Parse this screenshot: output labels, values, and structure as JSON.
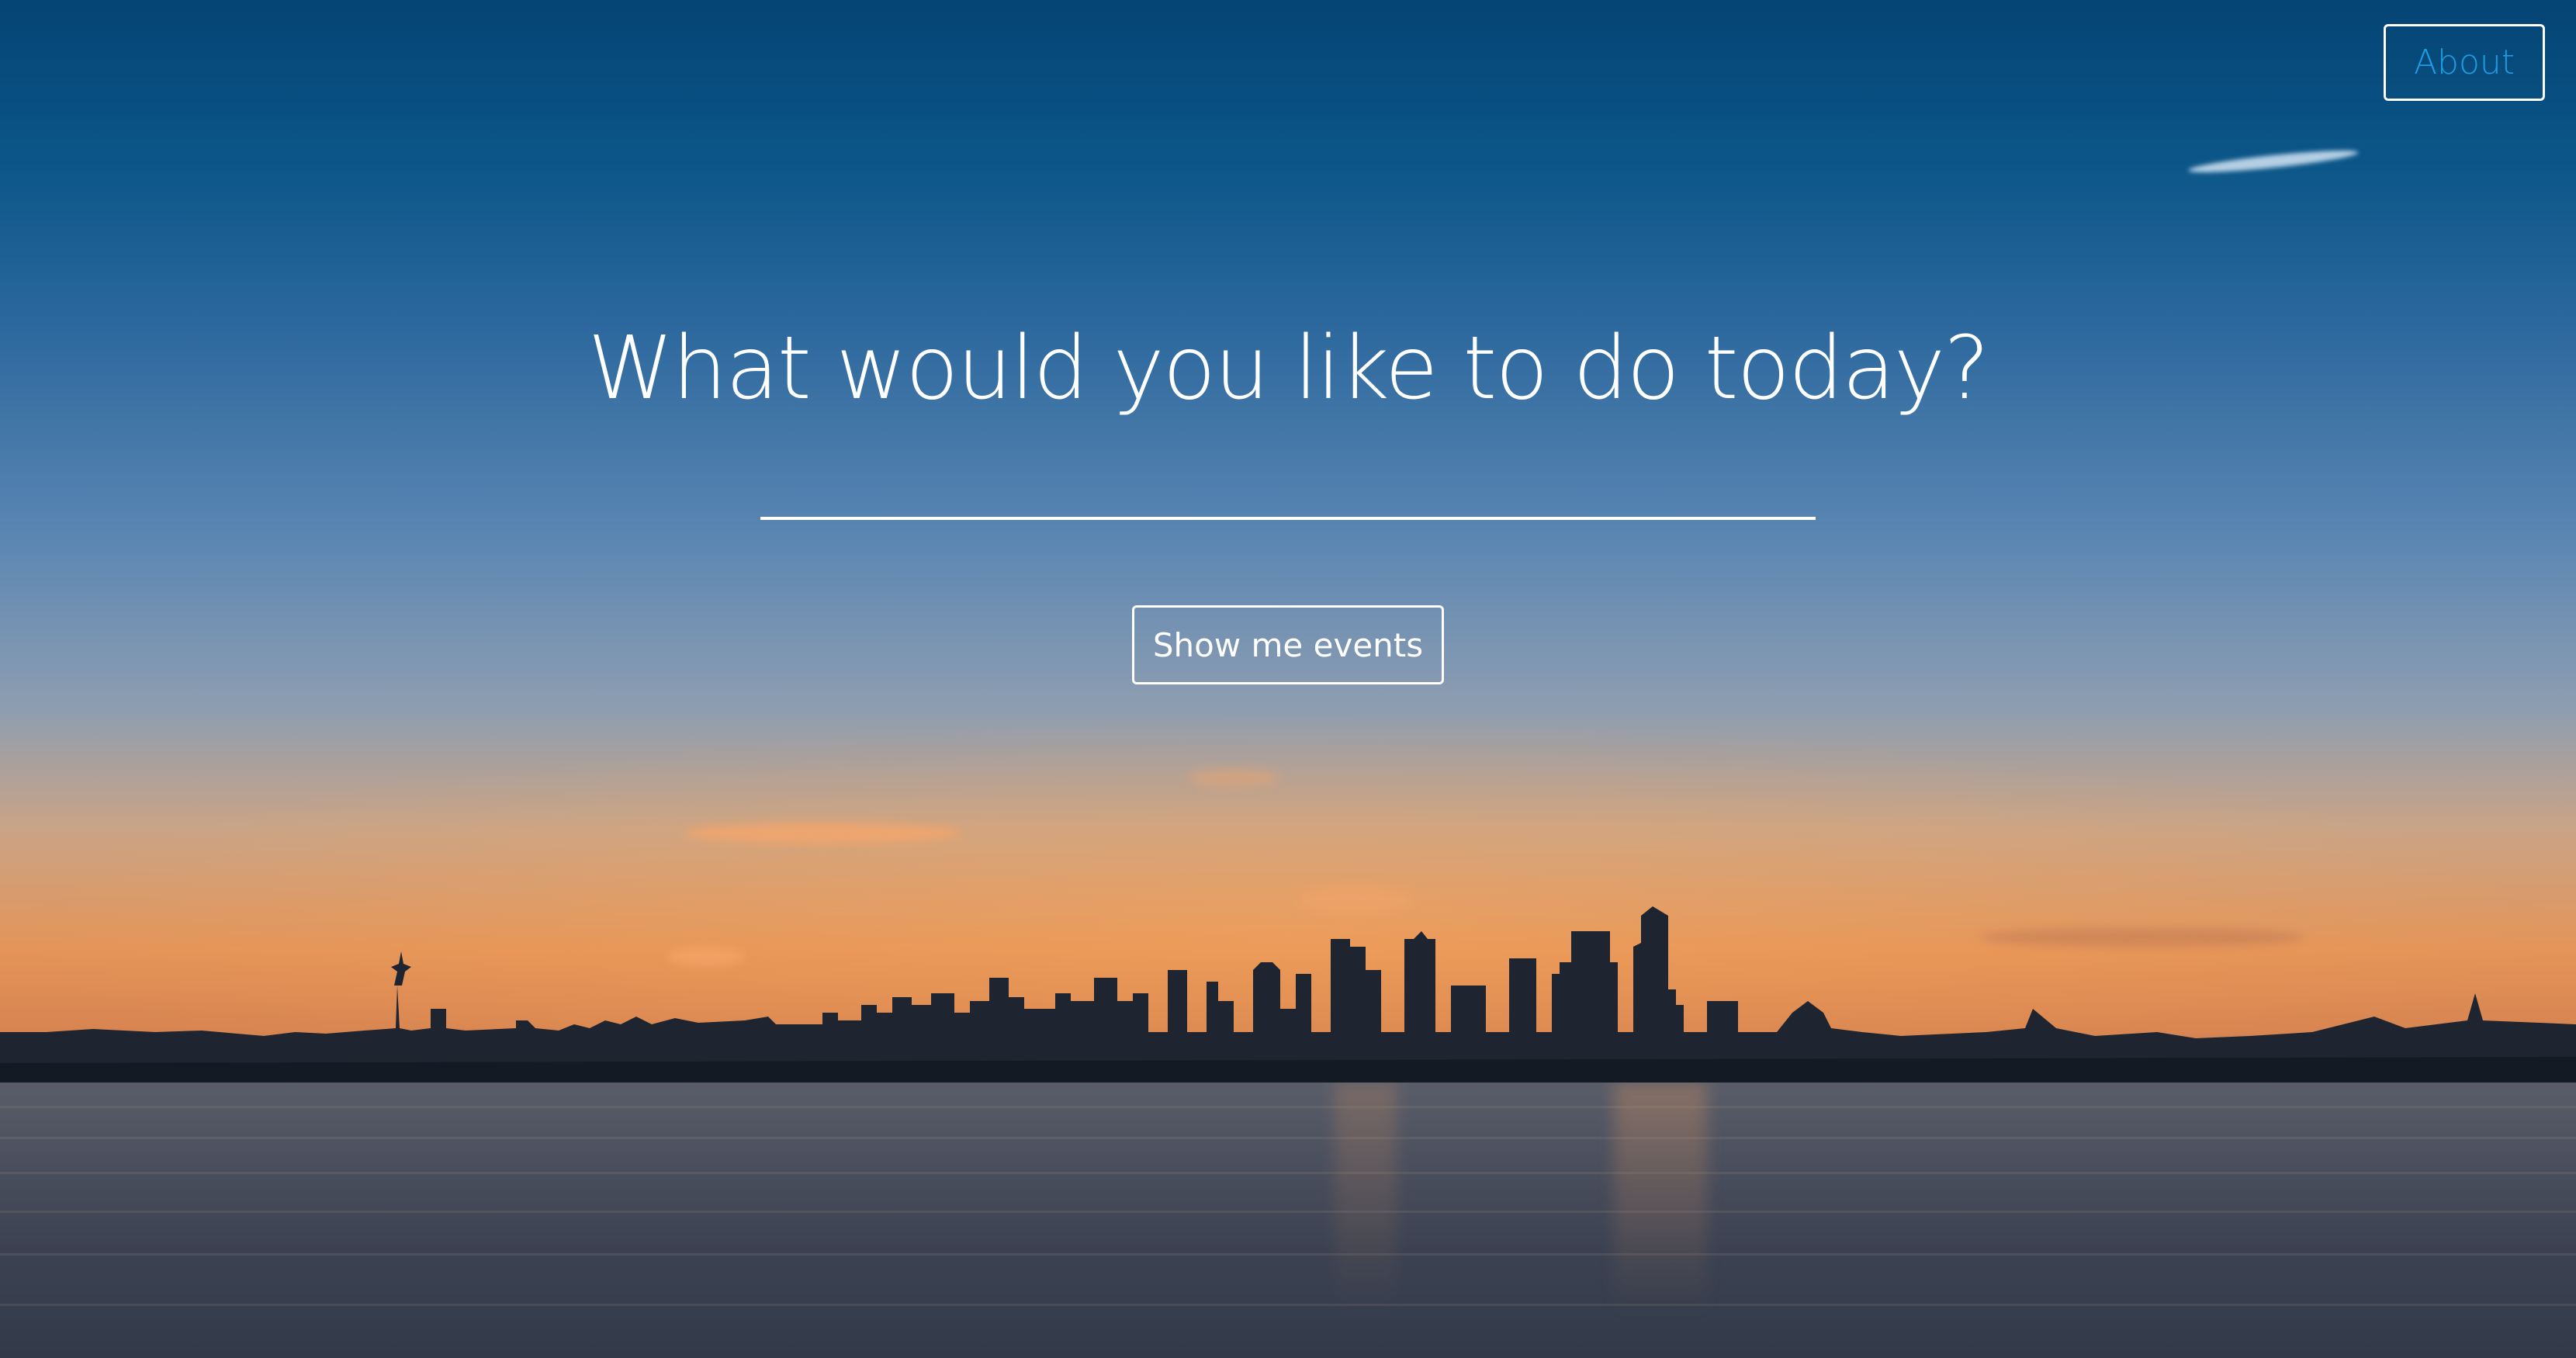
{
  "nav": {
    "about_label": "About"
  },
  "hero": {
    "title": "What would you like to do today?",
    "input_value": "",
    "input_placeholder": "",
    "button_label": "Show me events"
  },
  "colors": {
    "about_text": "#1e9be0",
    "hero_text": "#ffffff",
    "button_border": "#ffffff"
  },
  "background": {
    "description_icon": "city-skyline-sunset-photo"
  }
}
